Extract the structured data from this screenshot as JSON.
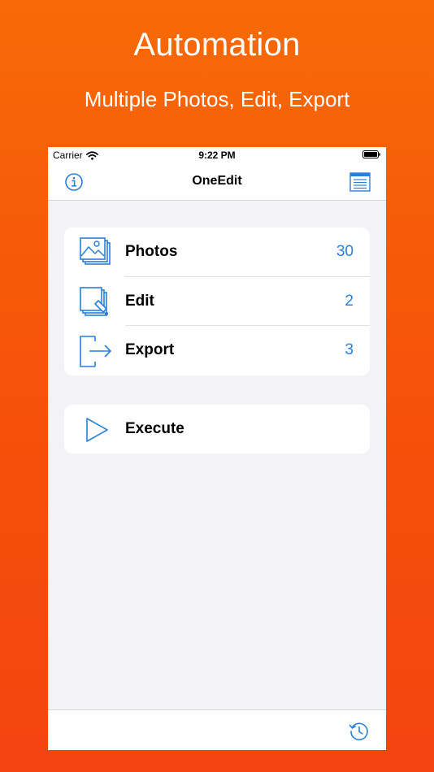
{
  "hero": {
    "title": "Automation",
    "subtitle": "Multiple Photos, Edit, Export"
  },
  "status_bar": {
    "carrier": "Carrier",
    "time": "9:22 PM"
  },
  "nav": {
    "title": "OneEdit",
    "left_icon": "info-icon",
    "right_icon": "list-icon"
  },
  "menu": {
    "items": [
      {
        "label": "Photos",
        "count": "30",
        "icon": "photos-stack-icon"
      },
      {
        "label": "Edit",
        "count": "2",
        "icon": "edit-stack-icon"
      },
      {
        "label": "Export",
        "count": "3",
        "icon": "export-icon"
      }
    ]
  },
  "execute": {
    "label": "Execute",
    "icon": "play-icon"
  },
  "toolbar": {
    "icon": "history-icon"
  },
  "colors": {
    "accent": "#2a7fd9",
    "background_top": "#f76a07",
    "background_bottom": "#f44410",
    "screen_background": "#f2f2f7"
  }
}
